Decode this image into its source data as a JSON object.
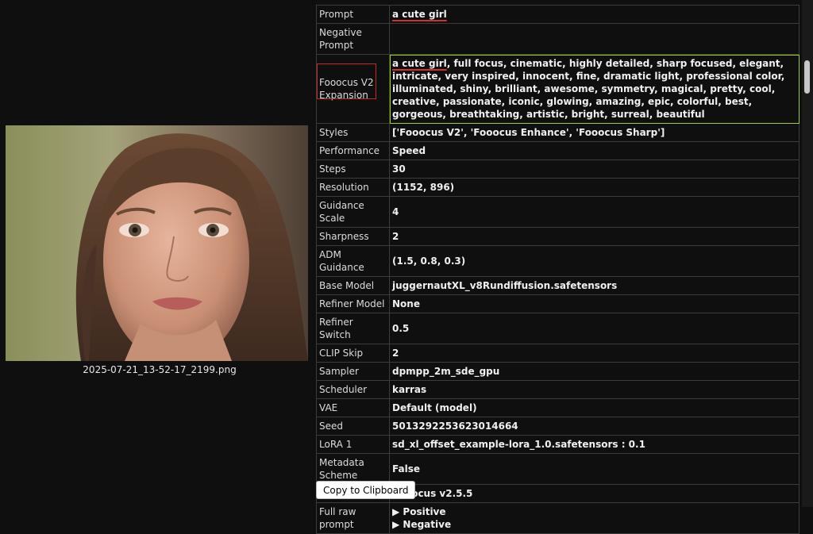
{
  "image": {
    "filename": "2025-07-21_13-52-17_2199.png"
  },
  "metadata": [
    {
      "key": "Prompt",
      "value": "a cute girl"
    },
    {
      "key": "Negative Prompt",
      "value": ""
    },
    {
      "key": "Fooocus V2 Expansion",
      "value_highlight": "a cute girl",
      "value_rest": ", full focus, cinematic, highly detailed, sharp focused, elegant, intricate, very inspired, innocent, fine, dramatic light, professional color, illuminated, shiny, brilliant, awesome, symmetry, magical, pretty, cool, creative, passionate, iconic, glowing, amazing, epic, colorful, best, gorgeous, breathtaking, artistic, bright, surreal, beautiful"
    },
    {
      "key": "Styles",
      "value": "['Fooocus V2', 'Fooocus Enhance', 'Fooocus Sharp']"
    },
    {
      "key": "Performance",
      "value": "Speed"
    },
    {
      "key": "Steps",
      "value": "30"
    },
    {
      "key": "Resolution",
      "value": "(1152, 896)"
    },
    {
      "key": "Guidance Scale",
      "value": "4"
    },
    {
      "key": "Sharpness",
      "value": "2"
    },
    {
      "key": "ADM Guidance",
      "value": "(1.5, 0.8, 0.3)"
    },
    {
      "key": "Base Model",
      "value": "juggernautXL_v8Rundiffusion.safetensors"
    },
    {
      "key": "Refiner Model",
      "value": "None"
    },
    {
      "key": "Refiner Switch",
      "value": "0.5"
    },
    {
      "key": "CLIP Skip",
      "value": "2"
    },
    {
      "key": "Sampler",
      "value": "dpmpp_2m_sde_gpu"
    },
    {
      "key": "Scheduler",
      "value": "karras"
    },
    {
      "key": "VAE",
      "value": "Default (model)"
    },
    {
      "key": "Seed",
      "value": "5013292253623014664"
    },
    {
      "key": "LoRA 1",
      "value": "sd_xl_offset_example-lora_1.0.safetensors : 0.1"
    },
    {
      "key": "Metadata Scheme",
      "value": "False"
    },
    {
      "key": "Version",
      "value": "Fooocus v2.5.5"
    },
    {
      "key": "Full raw prompt",
      "positive": "▶ Positive",
      "negative": "▶ Negative"
    }
  ],
  "copy_button": "Copy to Clipboard",
  "colors": {
    "background": "#0f0f0f",
    "border": "#3c3c3c",
    "highlight_red": "#c62828",
    "highlight_green": "#9acd32"
  }
}
